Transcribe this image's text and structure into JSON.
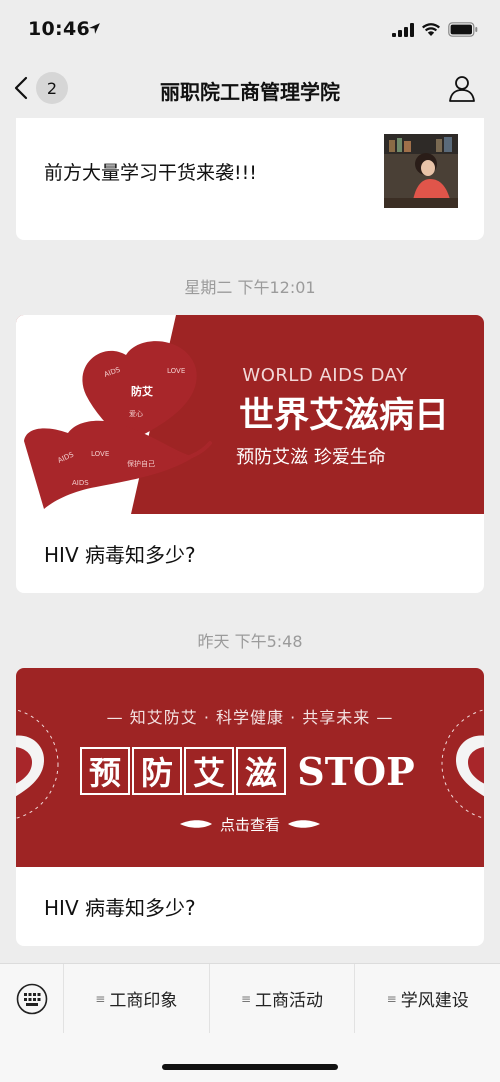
{
  "status_bar": {
    "time": "10:46"
  },
  "nav": {
    "back_count": "2",
    "title": "丽职院工商管理学院"
  },
  "articles": [
    {
      "title": "前方大量学习干货来袭!!!"
    },
    {
      "timestamp": "星期二 下午12:01",
      "banner": {
        "line1": "WORLD AIDS DAY",
        "line2": "世界艾滋病日",
        "line3": "预防艾滋 珍爱生命",
        "heart_word": "防艾"
      },
      "caption": "HIV 病毒知多少?"
    },
    {
      "timestamp": "昨天 下午5:48",
      "banner": {
        "line1": "— 知艾防艾  · 科学健康 · 共享未来 —",
        "chars": [
          "预",
          "防",
          "艾",
          "滋"
        ],
        "stop": "STOP",
        "cta": "点击查看"
      },
      "caption": "HIV 病毒知多少?"
    }
  ],
  "bottom_menu": {
    "items": [
      "工商印象",
      "工商活动",
      "学风建设"
    ]
  },
  "colors": {
    "accent_red": "#a8262a",
    "banner_red": "#9e2424"
  }
}
